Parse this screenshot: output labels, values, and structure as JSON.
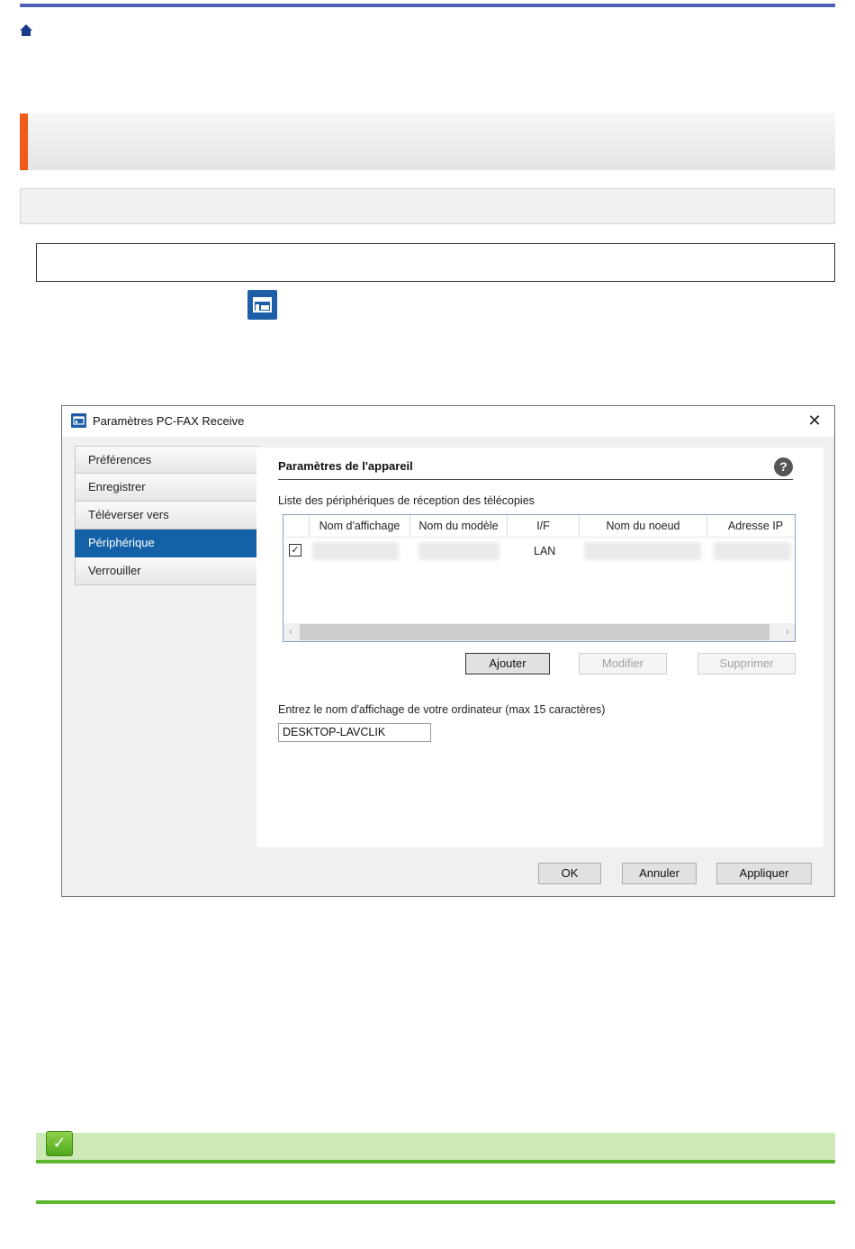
{
  "colors": {
    "top_rule": "#4f5fb3",
    "section_accent": "#f05a1a",
    "selected_nav": "#1561a8",
    "tip_bar": "#cce9b6",
    "tip_rule": "#5cb82c"
  },
  "icons": {
    "home": "home-icon",
    "app": "pc-fax-receive-icon",
    "help": "help-icon",
    "close": "close-icon",
    "tip": "checkmark-icon"
  },
  "dialog": {
    "title": "Paramètres PC-FAX Receive",
    "close_glyph": "✕",
    "nav": [
      {
        "label": "Préférences"
      },
      {
        "label": "Enregistrer"
      },
      {
        "label": "Téléverser vers"
      },
      {
        "label": "Périphérique",
        "selected": true
      },
      {
        "label": "Verrouiller"
      }
    ],
    "panel": {
      "title": "Paramètres de l'appareil",
      "help_glyph": "?",
      "list_label": "Liste des périphériques de réception des télécopies",
      "columns": [
        "Nom d'affichage",
        "Nom du modèle",
        "I/F",
        "Nom du noeud",
        "Adresse IP"
      ],
      "rows": [
        {
          "checked": true,
          "check_glyph": "✓",
          "interface": "LAN"
        }
      ],
      "scroll_left": "‹",
      "scroll_right": "›",
      "buttons": {
        "add": "Ajouter",
        "modify": "Modifier",
        "delete": "Supprimer"
      },
      "name_label": "Entrez le nom d'affichage de votre ordinateur (max 15 caractères)",
      "name_value": "DESKTOP-LAVCLIK"
    },
    "footer": {
      "ok": "OK",
      "cancel": "Annuler",
      "apply": "Appliquer"
    }
  },
  "tip": {
    "glyph": "✓"
  }
}
